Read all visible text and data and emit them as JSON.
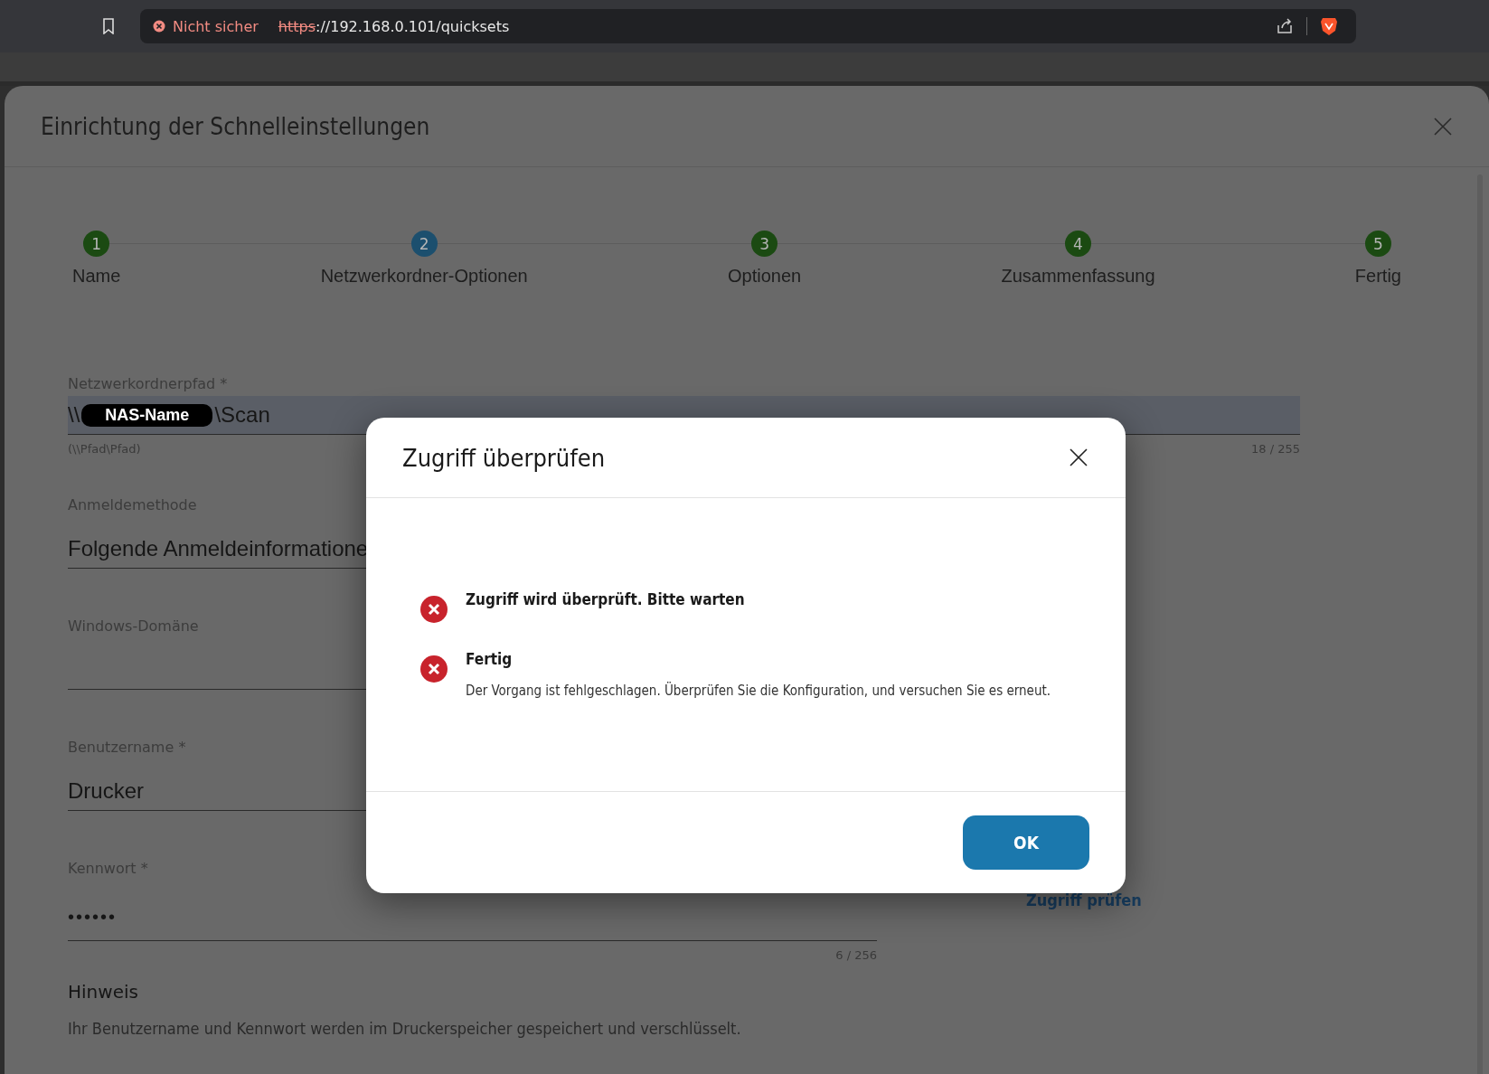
{
  "browser": {
    "security": "Nicht sicher",
    "url_scheme": "https",
    "url_rest": "://192.168.0.101/quicksets"
  },
  "page": {
    "title": "Einrichtung der Schnelleinstellungen"
  },
  "steps": [
    {
      "number": "1",
      "label": "Name",
      "selected": false
    },
    {
      "number": "2",
      "label": "Netzwerkordner-Optionen",
      "selected": true
    },
    {
      "number": "3",
      "label": "Optionen",
      "selected": false
    },
    {
      "number": "4",
      "label": "Zusammenfassung",
      "selected": false
    },
    {
      "number": "5",
      "label": "Fertig",
      "selected": false
    }
  ],
  "form": {
    "path": {
      "label": "Netzwerkordnerpfad *",
      "value_prefix": "\\\\",
      "value_redacted": "NAS-Name",
      "value_suffix": "\\Scan",
      "hint": "(\\\\Pfad\\Pfad)",
      "counter": "18 / 255"
    },
    "login_method": {
      "label": "Anmeldemethode",
      "value": "Folgende Anmeldeinformatione"
    },
    "domain": {
      "label": "Windows-Domäne"
    },
    "username": {
      "label": "Benutzername *",
      "value": "Drucker"
    },
    "password": {
      "label": "Kennwort *",
      "value": "••••••",
      "counter": "6 / 256"
    },
    "check_link": "Zugriff prüfen",
    "note": {
      "title": "Hinweis",
      "text": "Ihr Benutzername und Kennwort werden im Druckerspeicher gespeichert und verschlüsselt."
    }
  },
  "dialog": {
    "title": "Zugriff überprüfen",
    "messages": [
      {
        "kind": "error",
        "title": "Zugriff wird überprüft. Bitte warten"
      },
      {
        "kind": "error",
        "title": "Fertig",
        "detail": "Der Vorgang ist fehlgeschlagen. Überprüfen Sie die Konfiguration, und versuchen Sie es erneut."
      }
    ],
    "button": "OK"
  }
}
